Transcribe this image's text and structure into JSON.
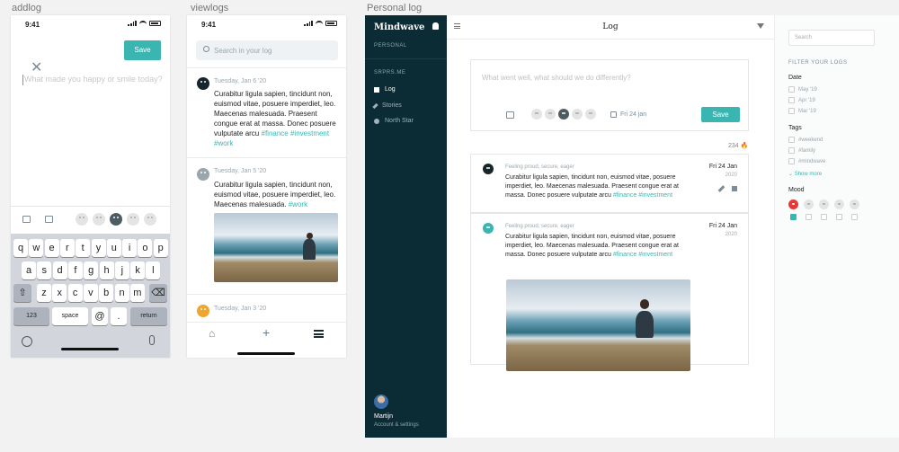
{
  "artboards": {
    "addlog": "addlog",
    "viewlogs": "viewlogs",
    "personal_log": "Personal log"
  },
  "status_time": "9:41",
  "addlog": {
    "save_label": "Save",
    "placeholder": "What made you happy or smile today?",
    "keyboard_row1": [
      "q",
      "w",
      "e",
      "r",
      "t",
      "y",
      "u",
      "i",
      "o",
      "p"
    ],
    "keyboard_row2": [
      "a",
      "s",
      "d",
      "f",
      "g",
      "h",
      "j",
      "k",
      "l"
    ],
    "keyboard_row3": [
      "z",
      "x",
      "c",
      "v",
      "b",
      "n",
      "m"
    ],
    "key_123": "123",
    "key_space": "space",
    "key_at": "@",
    "key_dot": ".",
    "key_return": "return"
  },
  "viewlogs": {
    "search_placeholder": "Search in your log",
    "entries": [
      {
        "date": "Tuesday, Jan 6 '20",
        "text": "Curabitur ligula sapien, tincidunt non, euismod vitae, posuere imperdiet, leo. Maecenas malesuada. Praesent congue erat at massa. Donec posuere vulputate arcu",
        "tags": "#finance #investment #work"
      },
      {
        "date": "Tuesday, Jan 5 '20",
        "text": "Curabitur ligula sapien, tincidunt non, euismod vitae, posuere imperdiet, leo. Maecenas malesuada.",
        "tags": "#work"
      },
      {
        "date": "Tuesday, Jan 3 '20"
      }
    ]
  },
  "desktop": {
    "logo": "Mindwave",
    "section_personal": "PERSONAL",
    "section_group": "SRPRS.ME",
    "nav": [
      {
        "label": "Log"
      },
      {
        "label": "Stories"
      },
      {
        "label": "North Star"
      }
    ],
    "user_name": "Martijn",
    "user_sub": "Account & settings",
    "page_title": "Log",
    "composer_placeholder": "What went well, what should we do differently?",
    "composer_date": "Fri 24 jan",
    "save_label": "Save",
    "streak": "234",
    "entries": [
      {
        "meta": "Feeling proud, secure, eager",
        "text": "Curabitur ligula sapien, tincidunt non, euismod vitae, posuere imperdiet, leo. Maecenas malesuada. Praesent congue erat at massa. Donec posuere vulputate arcu",
        "tags": "#finance #investment",
        "day": "Fri 24 Jan",
        "year": "2020"
      },
      {
        "meta": "Feeling proud, secure, eager",
        "text": "Curabitur ligula sapien, tincidunt non, euismod vitae, posuere imperdiet, leo. Maecenas malesuada. Praesent congue erat at massa. Donec posuere vulputate arcu",
        "tags": "#finance #investment",
        "day": "Fri 24 Jan",
        "year": "2020"
      }
    ],
    "filter": {
      "search_placeholder": "Search",
      "heading": "FILTER YOUR LOGS",
      "date_label": "Date",
      "dates": [
        "May '19",
        "Apr '19",
        "Mar '19"
      ],
      "tags_label": "Tags",
      "tags": [
        "#weekend",
        "#family",
        "#mindwave"
      ],
      "show_more": "Show more",
      "mood_label": "Mood"
    }
  },
  "colors": {
    "accent": "#3ab5b1",
    "sidebar": "#0b2b35"
  }
}
